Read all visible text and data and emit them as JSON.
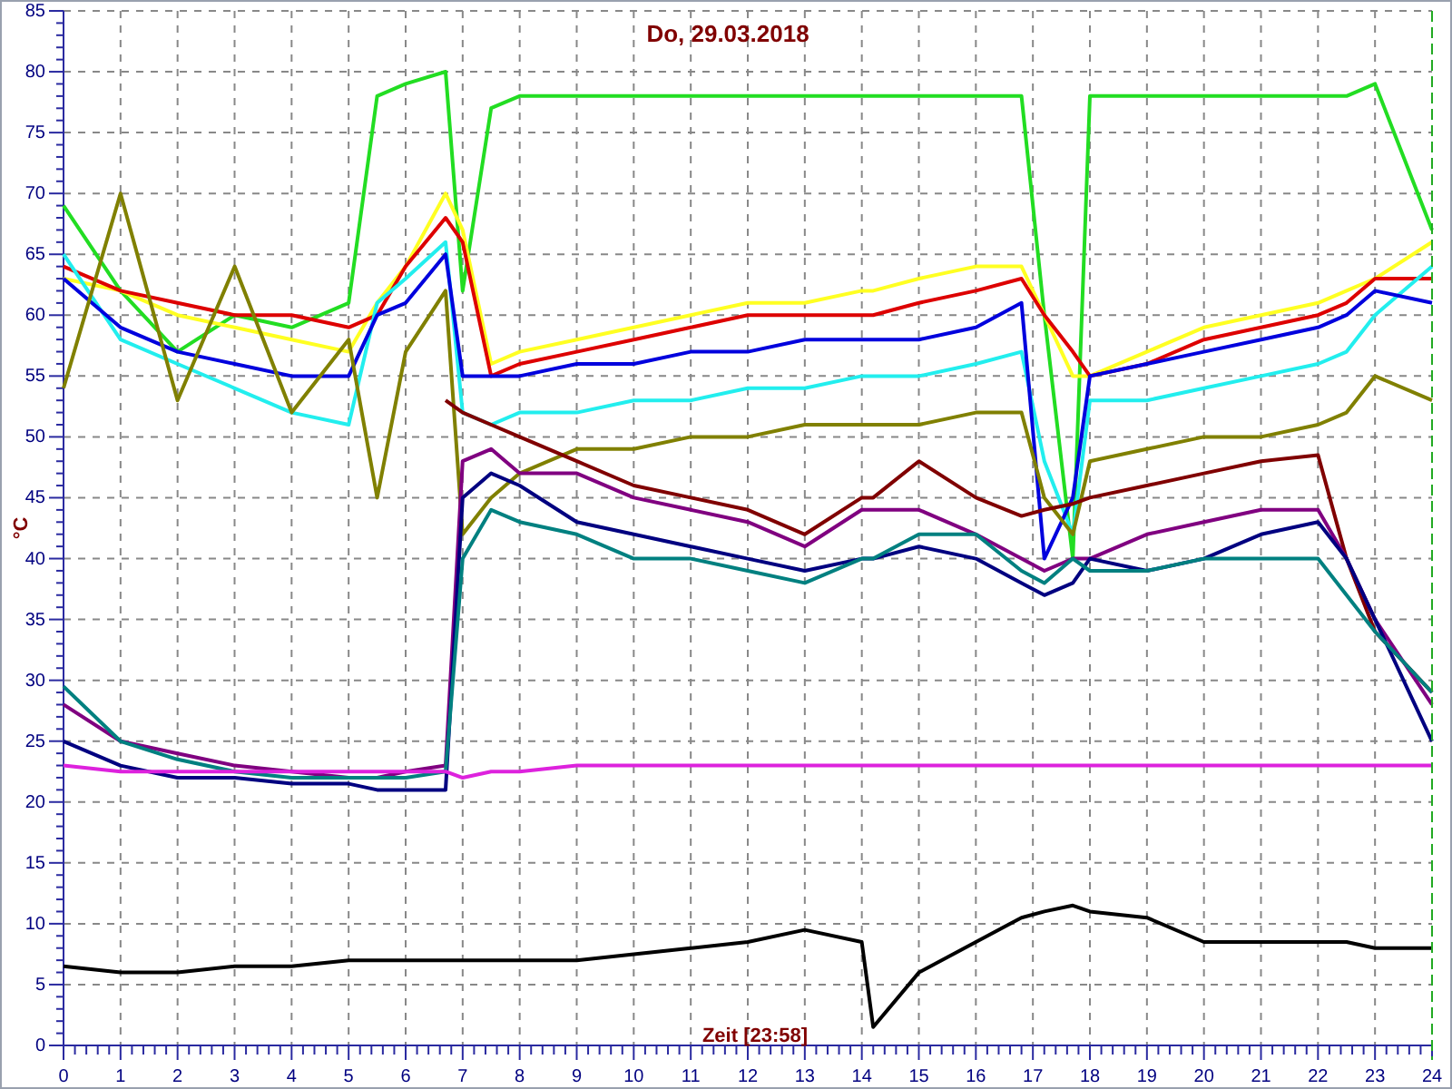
{
  "chart": {
    "chart_data": {
      "type": "line",
      "title": "Do, 29.03.2018",
      "xlabel": "Zeit [23:58]",
      "ylabel": "°C",
      "x": [
        0,
        1,
        2,
        3,
        4,
        5,
        5.5,
        6,
        6.7,
        7,
        7.5,
        8,
        9,
        10,
        11,
        12,
        13,
        14,
        14.2,
        15,
        16,
        16.8,
        17.2,
        17.7,
        18,
        19,
        20,
        21,
        22,
        22.5,
        23,
        24
      ],
      "xlim": [
        0,
        24
      ],
      "ylim": [
        0,
        85
      ],
      "grid": true,
      "xticks": [
        0,
        1,
        2,
        3,
        4,
        5,
        6,
        7,
        8,
        9,
        10,
        11,
        12,
        13,
        14,
        15,
        16,
        17,
        18,
        19,
        20,
        21,
        22,
        23,
        24
      ],
      "yticks": [
        0,
        5,
        10,
        15,
        20,
        25,
        30,
        35,
        40,
        45,
        50,
        55,
        60,
        65,
        70,
        75,
        80,
        85
      ],
      "series": [
        {
          "color": "#22dd22",
          "values": [
            69,
            62,
            57,
            60,
            59,
            61,
            78,
            79,
            80,
            62,
            77,
            78,
            78,
            78,
            78,
            78,
            78,
            78,
            78,
            78,
            78,
            78,
            60,
            40,
            78,
            78,
            78,
            78,
            78,
            78,
            79,
            67
          ]
        },
        {
          "color": "#ffff22",
          "values": [
            63,
            62,
            60,
            59,
            58,
            57,
            61,
            64,
            70,
            67,
            56,
            57,
            58,
            59,
            60,
            61,
            61,
            62,
            62,
            63,
            64,
            64,
            60,
            55,
            55,
            57,
            59,
            60,
            61,
            62,
            63,
            66
          ]
        },
        {
          "color": "#dd0000",
          "values": [
            64,
            62,
            61,
            60,
            60,
            59,
            60,
            64,
            68,
            66,
            55,
            56,
            57,
            58,
            59,
            60,
            60,
            60,
            60,
            61,
            62,
            63,
            60,
            57,
            55,
            56,
            58,
            59,
            60,
            61,
            63,
            63
          ]
        },
        {
          "color": "#22eeee",
          "values": [
            65,
            58,
            56,
            54,
            52,
            51,
            61,
            63,
            66,
            52,
            51,
            52,
            52,
            53,
            53,
            54,
            54,
            55,
            55,
            55,
            56,
            57,
            48,
            42,
            53,
            53,
            54,
            55,
            56,
            57,
            60,
            64
          ]
        },
        {
          "color": "#0000dd",
          "values": [
            63,
            59,
            57,
            56,
            55,
            55,
            60,
            61,
            65,
            55,
            55,
            55,
            56,
            56,
            57,
            57,
            58,
            58,
            58,
            58,
            59,
            61,
            40,
            45,
            55,
            56,
            57,
            58,
            59,
            60,
            62,
            61
          ]
        },
        {
          "color": "#808000",
          "values": [
            54,
            70,
            53,
            64,
            52,
            58,
            45,
            57,
            62,
            42,
            45,
            47,
            49,
            49,
            50,
            50,
            51,
            51,
            51,
            51,
            52,
            52,
            45,
            42,
            48,
            49,
            50,
            50,
            51,
            52,
            55,
            53
          ]
        },
        {
          "color": "#800000",
          "values": [
            null,
            null,
            null,
            null,
            null,
            null,
            null,
            null,
            53,
            52,
            51,
            50,
            48,
            46,
            45,
            44,
            42,
            45,
            45,
            48,
            45,
            43.5,
            44,
            44.5,
            45,
            46,
            47,
            48,
            48.5,
            40,
            34,
            29
          ]
        },
        {
          "color": "#800080",
          "values": [
            28,
            25,
            24,
            23,
            22.5,
            22,
            22,
            22.5,
            23,
            48,
            49,
            47,
            47,
            45,
            44,
            43,
            41,
            44,
            44,
            44,
            42,
            40,
            39,
            40,
            40,
            42,
            43,
            44,
            44,
            40,
            35,
            28
          ]
        },
        {
          "color": "#000080",
          "values": [
            25,
            23,
            22,
            22,
            21.5,
            21.5,
            21,
            21,
            21,
            45,
            47,
            46,
            43,
            42,
            41,
            40,
            39,
            40,
            40,
            41,
            40,
            38,
            37,
            38,
            40,
            39,
            40,
            42,
            43,
            40,
            35,
            25
          ]
        },
        {
          "color": "#008080",
          "values": [
            29.5,
            25,
            23.5,
            22.5,
            22,
            22,
            22,
            22,
            22.5,
            40,
            44,
            43,
            42,
            40,
            40,
            39,
            38,
            40,
            40,
            42,
            42,
            39,
            38,
            40,
            39,
            39,
            40,
            40,
            40,
            37,
            34,
            29
          ]
        },
        {
          "color": "#dd22dd",
          "values": [
            23,
            22.5,
            22.5,
            22.5,
            22.5,
            22.5,
            22.5,
            22.5,
            22.5,
            22,
            22.5,
            22.5,
            23,
            23,
            23,
            23,
            23,
            23,
            23,
            23,
            23,
            23,
            23,
            23,
            23,
            23,
            23,
            23,
            23,
            23,
            23,
            23
          ]
        },
        {
          "color": "#000000",
          "values": [
            6.5,
            6,
            6,
            6.5,
            6.5,
            7,
            7,
            7,
            7,
            7,
            7,
            7,
            7,
            7.5,
            8,
            8.5,
            9.5,
            8.5,
            1.5,
            6,
            8.5,
            10.5,
            11,
            11.5,
            11,
            10.5,
            8.5,
            8.5,
            8.5,
            8.5,
            8,
            8
          ]
        }
      ]
    }
  }
}
